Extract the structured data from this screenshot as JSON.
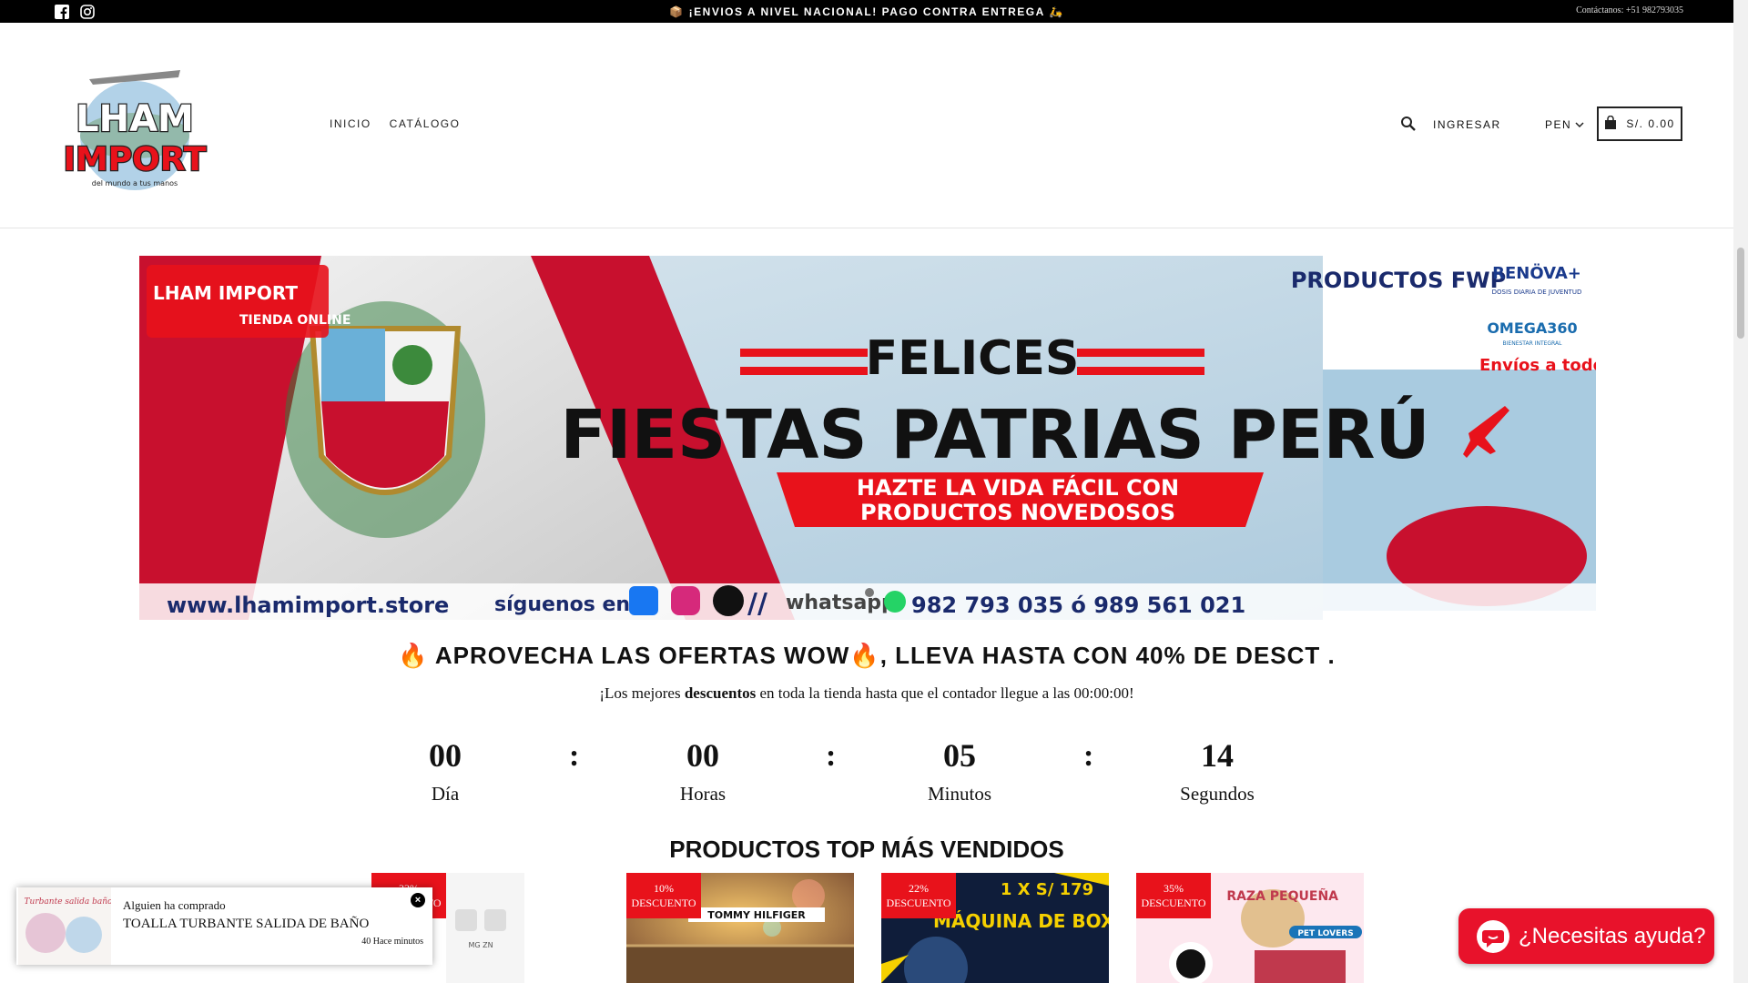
{
  "topbar": {
    "announcement": "📦 ¡ENVIOS A NIVEL NACIONAL! PAGO CONTRA ENTREGA 🛵",
    "contact": "Contáctanos: +51 982793035",
    "social": [
      "facebook-icon",
      "instagram-icon"
    ]
  },
  "header": {
    "logo_line1": "LHAM",
    "logo_line2": "IMPORT",
    "logo_tagline": "del mundo a tus manos",
    "nav": [
      "INICIO",
      "CATÁLOGO"
    ],
    "login": "INGRESAR",
    "currency": "PEN",
    "cart_total": "S/. 0.00"
  },
  "hero": {
    "badge": "LHAM IMPORT",
    "badge_sub": "TIENDA ONLINE",
    "felices": "FELICES",
    "headline": "FIESTAS PATRIAS PERÚ",
    "banner_line1": "HAZTE LA VIDA FÁCIL CON",
    "banner_line2": "PRODUCTOS NOVEDOSOS",
    "products_title": "PRODUCTOS FWP",
    "brand1": "RENÖVA+",
    "brand1_sub": "DOSIS DIARIA DE JUVENTUD",
    "brand2": "OMEGA360",
    "brand2_sub": "BIENESTAR INTEGRAL",
    "envios": "Envíos a todo el Perú",
    "website": "www.lhamimport.store",
    "follow": "síguenos en",
    "whatsapp": "whatsapp",
    "phones": "982 793 035 ó 989 561 021"
  },
  "promo": {
    "title": "🔥 APROVECHA LAS OFERTAS WOW🔥, LLEVA HASTA CON 40% DE DESCT .",
    "sub_before": "¡Los mejores ",
    "sub_bold": "descuentos",
    "sub_after": " en toda la tienda hasta que el contador llegue a las 00:00:00!"
  },
  "countdown": {
    "units": [
      {
        "value": "00",
        "label": "Día"
      },
      {
        "value": "00",
        "label": "Horas"
      },
      {
        "value": "05",
        "label": "Minutos"
      },
      {
        "value": "14",
        "label": "Segundos"
      }
    ],
    "separator": ":"
  },
  "section_title": "PRODUCTOS TOP MÁS VENDIDOS",
  "products": [
    {
      "badge_pct": "33%",
      "badge_text": "DESCUENTO",
      "img_text": "MG ZN"
    },
    {
      "badge_pct": "10%",
      "badge_text": "DESCUENTO",
      "img_text": "TOMMY HILFIGER"
    },
    {
      "badge_pct": "22%",
      "badge_text": "DESCUENTO",
      "img_text": "1 X S/ 179",
      "img_text2": "MÁQUINA DE BOXEO"
    },
    {
      "badge_pct": "35%",
      "badge_text": "DESCUENTO",
      "img_text": "RAZA PEQUEÑA",
      "img_text2": "PET LOVERS"
    }
  ],
  "toast": {
    "line1": "Alguien ha comprado",
    "product": "TOALLA TURBANTE SALIDA DE BAÑO",
    "time": "40 Hace minutos",
    "thumb_text": "Turbante salida baño"
  },
  "chat": {
    "label": "¿Necesitas ayuda?"
  },
  "colors": {
    "accent_red": "#e8121b",
    "chat_red": "#e8122b",
    "topbar": "#000000"
  }
}
